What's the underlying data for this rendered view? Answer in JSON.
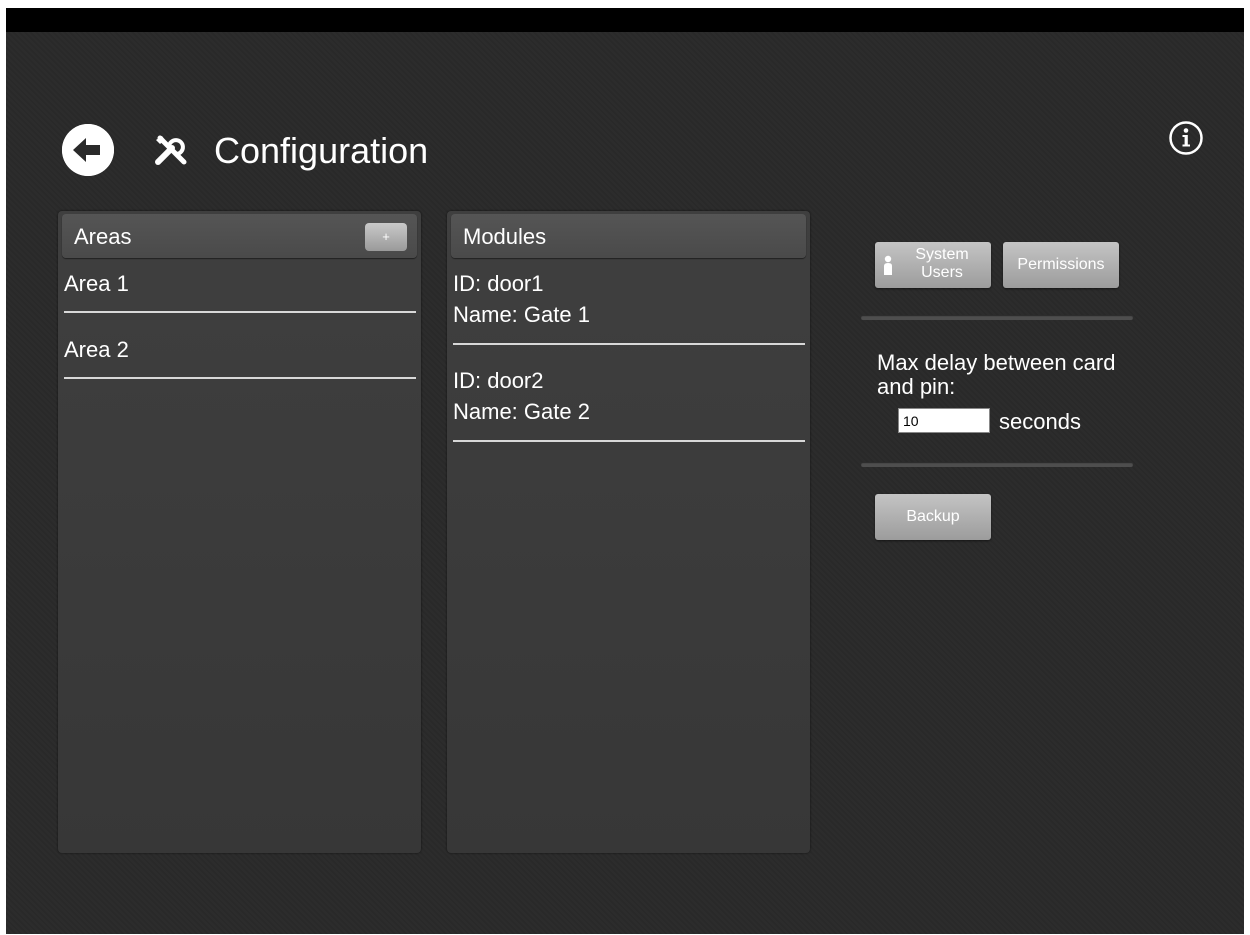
{
  "header": {
    "title": "Configuration",
    "back_icon": "arrow-left-circle-icon",
    "title_icon": "tools-icon",
    "info_icon": "info-icon"
  },
  "areas_panel": {
    "title": "Areas",
    "add_label": "+",
    "items": [
      {
        "label": "Area 1"
      },
      {
        "label": "Area 2"
      }
    ]
  },
  "modules_panel": {
    "title": "Modules",
    "items": [
      {
        "id_line": "ID: door1",
        "name_line": "Name: Gate 1"
      },
      {
        "id_line": "ID: door2",
        "name_line": "Name: Gate 2"
      }
    ]
  },
  "settings": {
    "system_users_label": "System Users",
    "system_users_icon": "person-icon",
    "permissions_label": "Permissions",
    "delay_label": "Max delay between card and pin:",
    "delay_value": "10",
    "delay_unit": "seconds",
    "backup_label": "Backup"
  },
  "colors": {
    "background": "#2a2a2a",
    "panel": "#3a3a3a",
    "button": "#b0b0b0",
    "text": "#ffffff"
  }
}
